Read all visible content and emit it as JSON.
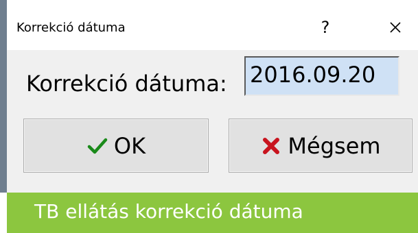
{
  "window": {
    "title": "Korrekció dátuma",
    "help_label": "?",
    "close_icon": "close-icon"
  },
  "form": {
    "date_label": "Korrekció dátuma:",
    "date_value": "2016.09.20"
  },
  "buttons": {
    "ok_label": "OK",
    "ok_icon": "checkmark-icon",
    "ok_icon_color": "#1a8a1a",
    "cancel_label": "Mégsem",
    "cancel_icon": "x-icon",
    "cancel_icon_color": "#c8141e"
  },
  "caption": {
    "text": "TB ellátás korrekció dátuma",
    "background_color": "#8cc63f"
  },
  "colors": {
    "input_background": "#cfe1f5",
    "dialog_background": "#f0f0f0"
  }
}
